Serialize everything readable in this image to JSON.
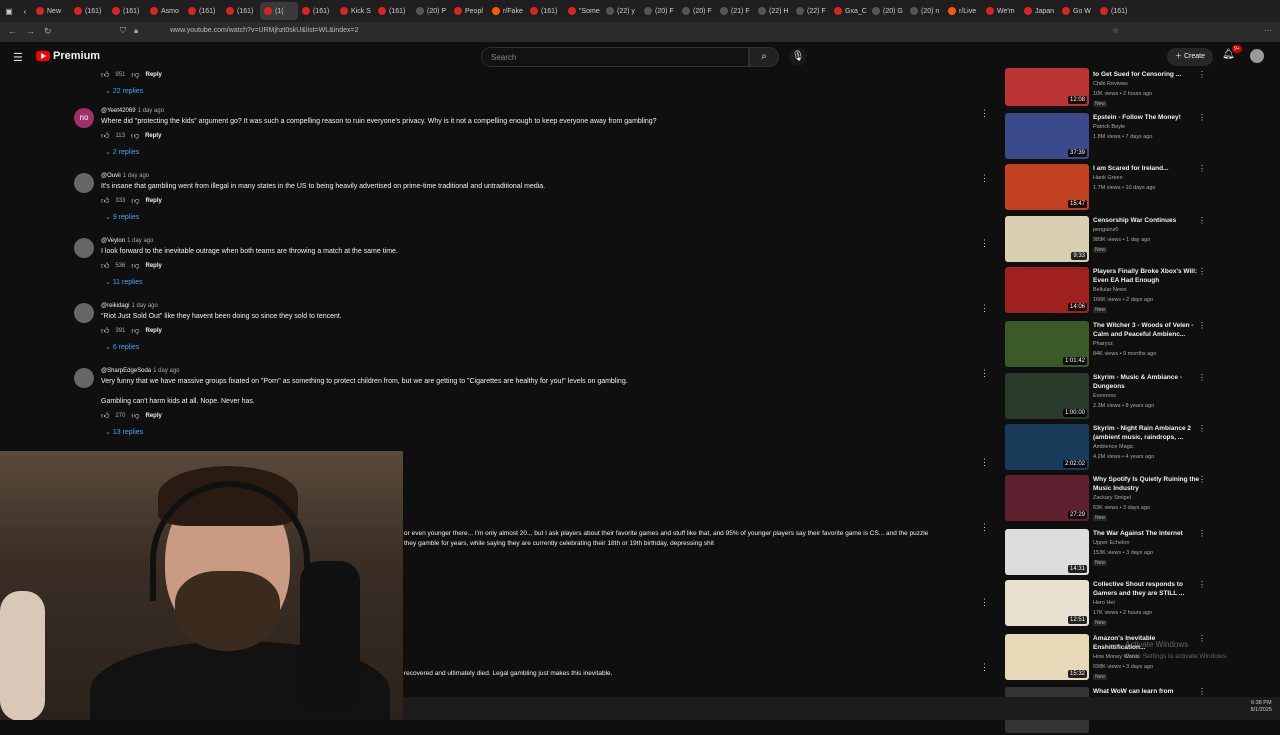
{
  "tabs": [
    {
      "label": "New"
    },
    {
      "label": "(161)"
    },
    {
      "label": "(161)"
    },
    {
      "label": "Asmo"
    },
    {
      "label": "(161)"
    },
    {
      "label": "(161)"
    },
    {
      "label": "(1("
    },
    {
      "label": "(161)"
    },
    {
      "label": "Kick S"
    },
    {
      "label": "(161)"
    },
    {
      "label": "(20) P"
    },
    {
      "label": "Peopl"
    },
    {
      "label": "r/Fake"
    },
    {
      "label": "(161)"
    },
    {
      "label": "\"Some"
    },
    {
      "label": "(22) y"
    },
    {
      "label": "(20) F"
    },
    {
      "label": "(20) F"
    },
    {
      "label": "(21) F"
    },
    {
      "label": "(22) H"
    },
    {
      "label": "(22) F"
    },
    {
      "label": "Gxa_C"
    },
    {
      "label": "(20) G"
    },
    {
      "label": "(20) n"
    },
    {
      "label": "r/Live"
    },
    {
      "label": "We'm"
    },
    {
      "label": "Japan"
    },
    {
      "label": "Go W"
    },
    {
      "label": "(161)"
    }
  ],
  "address_bar": {
    "url": "www.youtube.com/watch?v=URMjhzt0skU&list=WL&index=2"
  },
  "header": {
    "logo_text": "Premium",
    "search_placeholder": "Search",
    "create_label": "Create",
    "notif_count": "9+"
  },
  "comments": [
    {
      "author": "",
      "time": "",
      "text": "",
      "likes": "951",
      "reply_label": "Reply",
      "replies_label": "22 replies",
      "avatar": ""
    },
    {
      "author": "@Yeet42069",
      "time": "1 day ago",
      "text": "Where did \"protecting the kids\" argument go? It was such a compelling reason to ruin everyone's privacy. Why is it not a compelling enough to keep everyone away from gambling?",
      "likes": "113",
      "reply_label": "Reply",
      "replies_label": "2 replies",
      "avatar": "no"
    },
    {
      "author": "@Ouvii",
      "time": "1 day ago",
      "text": "It's insane that gambling went from illegal in many states in the US to being heavily advertised on prime-time traditional and untraditional media.",
      "likes": "333",
      "reply_label": "Reply",
      "replies_label": "9 replies",
      "avatar": ""
    },
    {
      "author": "@Veylon",
      "time": "1 day ago",
      "text": "I look forward to the inevitable outrage when both teams are throwing a match at the same time.",
      "likes": "536",
      "reply_label": "Reply",
      "replies_label": "11 replies",
      "avatar": ""
    },
    {
      "author": "@reikidagi",
      "time": "1 day ago",
      "text": "\"Riot Just Sold Out\"  like they havent been doing so since they sold to tencent.",
      "likes": "391",
      "reply_label": "Reply",
      "replies_label": "6 replies",
      "avatar": ""
    },
    {
      "author": "@SharpEdgeSoda",
      "time": "1 day ago",
      "text": "Very funny that we have massive groups fixated on \"Porn\" as something to protect children from, but we are getting to \"Cigarettes are healthy for you!\" levels on gambling.",
      "text2": "Gambling can't harm kids at all. Nope. Never has.",
      "likes": "270",
      "reply_label": "Reply",
      "replies_label": "13 replies",
      "avatar": ""
    }
  ],
  "partial_comments": {
    "line1": "or even younger there... I'm only almost 20... but I ask players about their favorite games and stuff like that, and 95% of younger players say their favorite game is CS... and the puzzle",
    "line2": "they gamble for years, while saying they are currently celebrating their 18th or 19th birthday, depressing shit",
    "line3": "recovered and ultimately died. Legal gambling just makes this inevitable."
  },
  "videos": [
    {
      "title": "to Get Sued for Censoring ...",
      "channel": "Chibi Reviews",
      "meta": "10K views • 2 hours ago",
      "new": "New",
      "duration": "12:08",
      "color": "#b33"
    },
    {
      "title": "Epstein - Follow The Money!",
      "channel": "Patrick Boyle",
      "meta": "1.8M views • 7 days ago",
      "new": "",
      "duration": "37:39",
      "color": "#3a4a8a"
    },
    {
      "title": "I am Scared for Ireland...",
      "channel": "Hank Green",
      "meta": "1.7M views • 10 days ago",
      "new": "",
      "duration": "15:47",
      "color": "#c04020"
    },
    {
      "title": "Censorship War Continues",
      "channel": "penguinz0",
      "meta": "989K views • 1 day ago",
      "new": "New",
      "duration": "9:33",
      "color": "#d8d0b0"
    },
    {
      "title": "Players Finally Broke Xbox's Will: Even EA Had Enough",
      "channel": "Bellular News",
      "meta": "166K views • 2 days ago",
      "new": "New",
      "duration": "14:06",
      "color": "#a02020"
    },
    {
      "title": "The Witcher 3 - Woods of Velen - Calm and Peaceful Ambienc...",
      "channel": "Pharysz",
      "meta": "84K views • 9 months ago",
      "new": "",
      "duration": "1:01:42",
      "color": "#3a5a2a"
    },
    {
      "title": "Skyrim - Music & Ambiance - Dungeons",
      "channel": "Everness",
      "meta": "2.3M views • 8 years ago",
      "new": "",
      "duration": "1:00:00",
      "color": "#2a3a2a"
    },
    {
      "title": "Skyrim - Night Rain Ambiance 2 (ambient music, raindrops, ...",
      "channel": "Ambience Magic",
      "meta": "4.2M views • 4 years ago",
      "new": "",
      "duration": "2:02:02",
      "color": "#1a3a5a"
    },
    {
      "title": "Why Spotify Is Quietly Ruining the Music Industry",
      "channel": "Zackary Smigel",
      "meta": "63K views • 3 days ago",
      "new": "New",
      "duration": "27:29",
      "color": "#602030"
    },
    {
      "title": "The War Against The Internet",
      "channel": "Upper Echelon",
      "meta": "153K views • 3 days ago",
      "new": "New",
      "duration": "14:31",
      "color": "#dddddd"
    },
    {
      "title": "Collective Shout responds to Gamers and they are STILL ...",
      "channel": "Hero Hei",
      "meta": "17K views • 2 hours ago",
      "new": "New",
      "duration": "12:51",
      "color": "#e8e0d0"
    },
    {
      "title": "Amazon's Inevitable Enshittification...",
      "channel": "How Money Works",
      "meta": "698K views • 3 days ago",
      "new": "New",
      "duration": "15:32",
      "color": "#e8d8b8"
    },
    {
      "title": "What WoW can learn from",
      "channel": "",
      "meta": "",
      "new": "",
      "duration": "",
      "color": "#333"
    }
  ],
  "watermark": {
    "line1": "Activate Windows",
    "line2": "Go to Settings to activate Windows."
  },
  "clock": {
    "time": "6:38 PM",
    "date": "8/1/2025"
  }
}
